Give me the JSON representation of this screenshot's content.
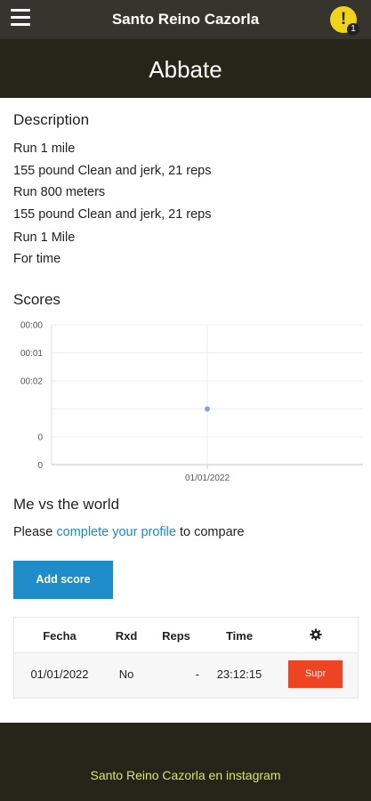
{
  "topbar": {
    "title": "Santo Reino Cazorla",
    "alert_mark": "!",
    "alert_count": "1"
  },
  "wod": {
    "title": "Abbate"
  },
  "description": {
    "heading": "Description",
    "lines": [
      "Run 1 mile",
      "155 pound Clean and jerk, 21 reps",
      "Run 800 meters",
      "155 pound Clean and jerk, 21 reps",
      "Run 1 Mile",
      "For time"
    ]
  },
  "scores": {
    "heading": "Scores"
  },
  "chart_data": {
    "type": "scatter",
    "title": "",
    "xlabel": "",
    "ylabel": "",
    "y_tick_labels": [
      "00:00",
      "00:01",
      "00:02",
      "0",
      "0"
    ],
    "x_tick_labels": [
      "01/01/2022"
    ],
    "points": [
      {
        "x": "01/01/2022",
        "y": "23:12:15"
      }
    ],
    "grid": true,
    "point_color": "#7fa8d6"
  },
  "compare": {
    "heading": "Me vs the world",
    "prefix": "Please ",
    "link": "complete your profile",
    "suffix": " to compare"
  },
  "add_score_label": "Add score",
  "table": {
    "headers": [
      "Fecha",
      "Rxd",
      "Reps",
      "Time",
      "gear-icon"
    ],
    "rows": [
      {
        "fecha": "01/01/2022",
        "rxd": "No",
        "reps": "-",
        "time": "23:12:15",
        "action": "Supr"
      }
    ]
  },
  "footer": {
    "link": "Santo Reino Cazorla en instagram"
  },
  "colors": {
    "header_bg": "#262519",
    "topbar_bg": "#35352d",
    "accent_blue": "#1d8cc9",
    "alert_yellow": "#f1d418",
    "delete_red": "#ef4423",
    "footer_link": "#d5e86a"
  }
}
